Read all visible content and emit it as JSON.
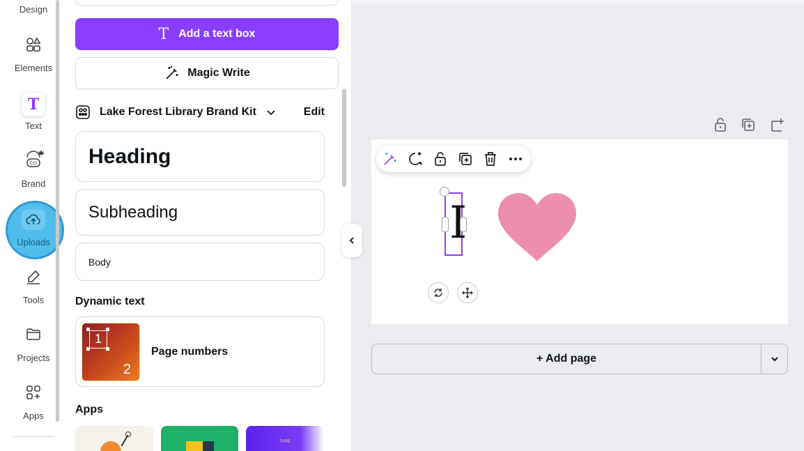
{
  "rail": {
    "items": [
      {
        "label": "Design"
      },
      {
        "label": "Elements"
      },
      {
        "label": "Text"
      },
      {
        "label": "Brand"
      },
      {
        "label": "Uploads"
      },
      {
        "label": "Tools"
      },
      {
        "label": "Projects"
      },
      {
        "label": "Apps"
      }
    ],
    "active_index": 2,
    "highlight_index": 4
  },
  "panel": {
    "add_text_box_label": "Add a text box",
    "magic_write_label": "Magic Write",
    "brand_kit": {
      "name": "Lake Forest Library Brand Kit",
      "edit_label": "Edit"
    },
    "styles": [
      {
        "label": "Heading"
      },
      {
        "label": "Subheading"
      },
      {
        "label": "Body"
      }
    ],
    "dynamic_text": {
      "title": "Dynamic text",
      "item_label": "Page numbers",
      "thumb_digits": [
        "1",
        "2"
      ]
    },
    "apps": {
      "title": "Apps",
      "tile_caption": "TYPE"
    }
  },
  "canvas": {
    "selected_text": "I",
    "add_page_label": "+ Add page"
  },
  "colors": {
    "accent_purple": "#8b3dff",
    "highlight_blue": "#1aa3e0",
    "heart_pink": "#ec8fae",
    "canvas_bg": "#ebecf0"
  }
}
